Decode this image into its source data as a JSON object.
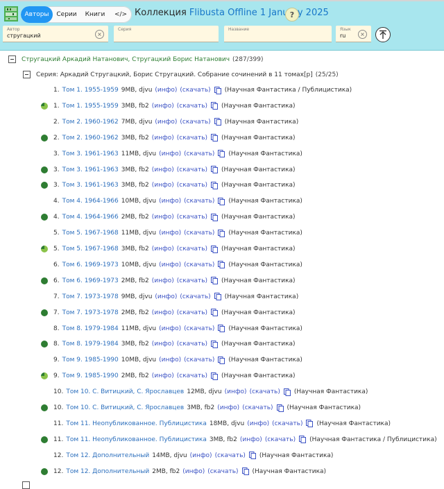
{
  "nav": {
    "tabs": [
      {
        "label": "Авторы",
        "active": true
      },
      {
        "label": "Серии",
        "active": false
      },
      {
        "label": "Книги",
        "active": false
      },
      {
        "label": "</>",
        "active": false
      }
    ]
  },
  "header": {
    "prefix": "Коллекция",
    "collection": "Flibusta Offline 1 January 2025",
    "help": "?"
  },
  "search": {
    "author": {
      "label": "Автор",
      "value": "стругацкий"
    },
    "series": {
      "label": "Серия",
      "value": ""
    },
    "title": {
      "label": "Название",
      "value": ""
    },
    "lang": {
      "label": "Язык",
      "value": "ru"
    }
  },
  "author": {
    "name": "Стругацкий Аркадий Натанович, Стругацкий Борис Натанович",
    "count": "(287/399)"
  },
  "series": {
    "name": "Серия: Аркадий Стругацкий, Борис Стругацкий. Собрание сочинений в 11 томах[р]",
    "count": "(25/25)"
  },
  "links": {
    "info": "(инфо)",
    "download": "(скачать)"
  },
  "colors": {
    "dot_green": "#2e7d32",
    "dot_light": "#8bc34a",
    "link": "#2c6fbd",
    "accent": "#2196f3"
  },
  "books": [
    {
      "num": "1.",
      "title": "Том 1. 1955-1959",
      "size": "9MB, djvu",
      "genre": "(Научная Фантастика / Публицистика)",
      "status": "none"
    },
    {
      "num": "1.",
      "title": "Том 1. 1955-1959",
      "size": "3MB, fb2",
      "genre": "(Научная Фантастика)",
      "status": "partial"
    },
    {
      "num": "2.",
      "title": "Том 2. 1960-1962",
      "size": "7MB, djvu",
      "genre": "(Научная Фантастика)",
      "status": "none"
    },
    {
      "num": "2.",
      "title": "Том 2. 1960-1962",
      "size": "3MB, fb2",
      "genre": "(Научная Фантастика)",
      "status": "full"
    },
    {
      "num": "3.",
      "title": "Том 3. 1961-1963",
      "size": "11MB, djvu",
      "genre": "(Научная Фантастика)",
      "status": "none"
    },
    {
      "num": "3.",
      "title": "Том 3. 1961-1963",
      "size": "3MB, fb2",
      "genre": "(Научная Фантастика)",
      "status": "full"
    },
    {
      "num": "3.",
      "title": "Том 3. 1961-1963",
      "size": "3MB, fb2",
      "genre": "(Научная Фантастика)",
      "status": "full"
    },
    {
      "num": "4.",
      "title": "Том 4. 1964-1966",
      "size": "10MB, djvu",
      "genre": "(Научная Фантастика)",
      "status": "none"
    },
    {
      "num": "4.",
      "title": "Том 4. 1964-1966",
      "size": "2MB, fb2",
      "genre": "(Научная Фантастика)",
      "status": "full"
    },
    {
      "num": "5.",
      "title": "Том 5. 1967-1968",
      "size": "11MB, djvu",
      "genre": "(Научная Фантастика)",
      "status": "none"
    },
    {
      "num": "5.",
      "title": "Том 5. 1967-1968",
      "size": "3MB, fb2",
      "genre": "(Научная Фантастика)",
      "status": "partial"
    },
    {
      "num": "6.",
      "title": "Том 6. 1969-1973",
      "size": "10MB, djvu",
      "genre": "(Научная Фантастика)",
      "status": "none"
    },
    {
      "num": "6.",
      "title": "Том 6. 1969-1973",
      "size": "2MB, fb2",
      "genre": "(Научная Фантастика)",
      "status": "full"
    },
    {
      "num": "7.",
      "title": "Том 7. 1973-1978",
      "size": "9MB, djvu",
      "genre": "(Научная Фантастика)",
      "status": "none"
    },
    {
      "num": "7.",
      "title": "Том 7. 1973-1978",
      "size": "2MB, fb2",
      "genre": "(Научная Фантастика)",
      "status": "full"
    },
    {
      "num": "8.",
      "title": "Том 8. 1979-1984",
      "size": "11MB, djvu",
      "genre": "(Научная Фантастика)",
      "status": "none"
    },
    {
      "num": "8.",
      "title": "Том 8. 1979-1984",
      "size": "3MB, fb2",
      "genre": "(Научная Фантастика)",
      "status": "full"
    },
    {
      "num": "9.",
      "title": "Том 9. 1985-1990",
      "size": "10MB, djvu",
      "genre": "(Научная Фантастика)",
      "status": "none"
    },
    {
      "num": "9.",
      "title": "Том 9. 1985-1990",
      "size": "2MB, fb2",
      "genre": "(Научная Фантастика)",
      "status": "partial"
    },
    {
      "num": "10.",
      "title": "Том 10. С. Витицкий, С. Ярославцев",
      "size": "12MB, djvu",
      "genre": "(Научная Фантастика)",
      "status": "none"
    },
    {
      "num": "10.",
      "title": "Том 10. С. Витицкий, С. Ярославцев",
      "size": "3MB, fb2",
      "genre": "(Научная Фантастика)",
      "status": "full"
    },
    {
      "num": "11.",
      "title": "Том 11. Неопубликованное. Публицистика",
      "size": "18MB, djvu",
      "genre": "(Научная Фантастика)",
      "status": "none"
    },
    {
      "num": "11.",
      "title": "Том 11. Неопубликованное. Публицистика",
      "size": "3MB, fb2",
      "genre": "(Научная Фантастика / Публицистика)",
      "status": "full"
    },
    {
      "num": "12.",
      "title": "Том 12. Дополнительный",
      "size": "14MB, djvu",
      "genre": "(Научная Фантастика)",
      "status": "none"
    },
    {
      "num": "12.",
      "title": "Том 12. Дополнительный",
      "size": "2MB, fb2",
      "genre": "(Научная Фантастика)",
      "status": "full"
    }
  ]
}
